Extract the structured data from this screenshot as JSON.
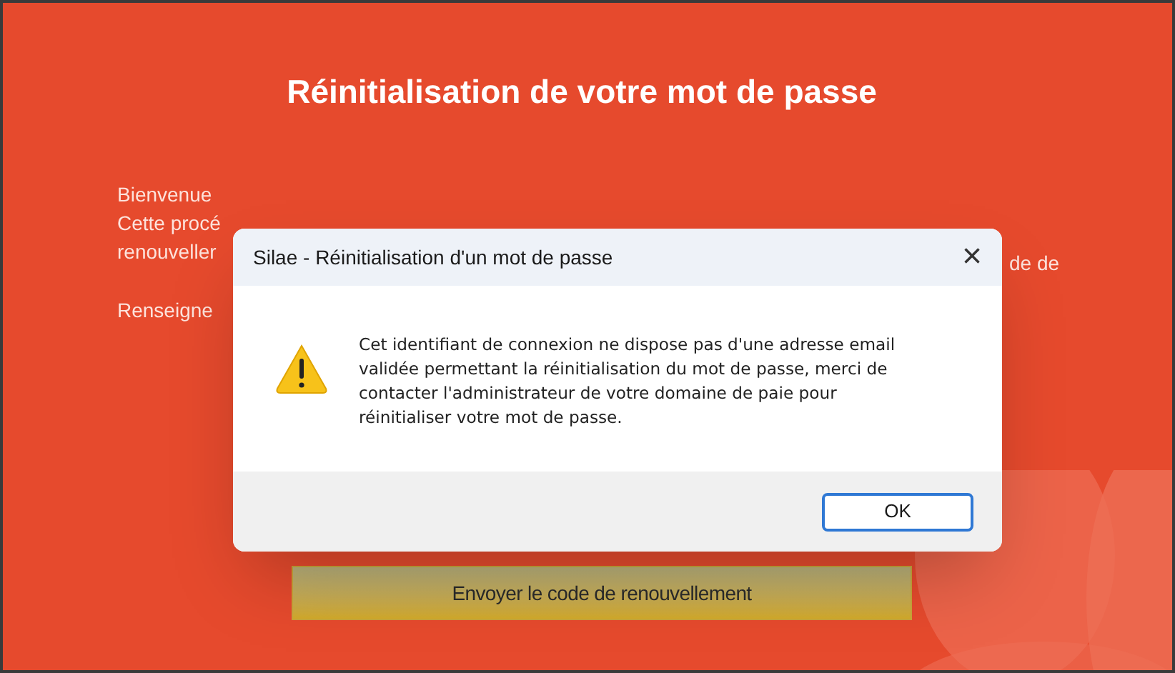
{
  "page": {
    "title": "Réinitialisation de votre mot de passe",
    "intro_lines": [
      "Bienvenue",
      "Cette procé",
      "renouveller"
    ],
    "intro_right": "de de",
    "prompt": "Renseigne",
    "send_button": "Envoyer le code de renouvellement"
  },
  "dialog": {
    "title": "Silae - Réinitialisation d'un mot de passe",
    "close": "×",
    "kind": "warning",
    "message": "Cet identifiant de connexion ne dispose pas d'une adresse email validée permettant la réinitialisation du mot de passe, merci de contacter l'administrateur de votre domaine de paie pour réinitialiser votre mot de passe.",
    "buttons": [
      "OK"
    ]
  }
}
